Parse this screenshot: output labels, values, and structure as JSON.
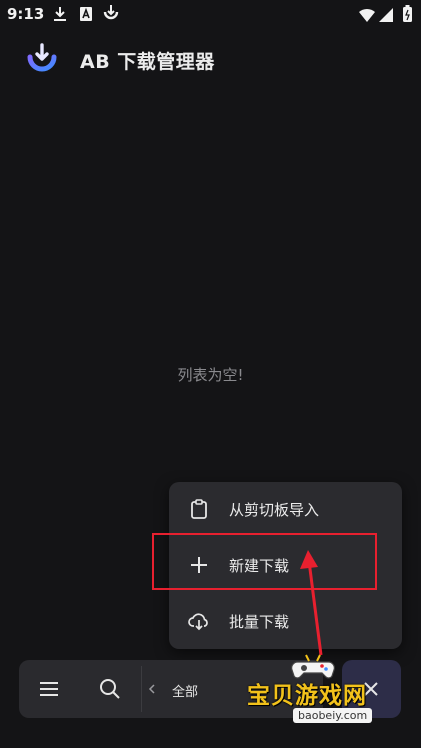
{
  "status_bar": {
    "time": "9:13",
    "left_icons": [
      "download-icon",
      "a-badge-icon",
      "app-download-icon"
    ],
    "right_icons": [
      "wifi-icon",
      "signal-icon",
      "battery-icon"
    ]
  },
  "app_bar": {
    "title": "AB 下载管理器",
    "logo_icon": "ab-download-logo-icon"
  },
  "main": {
    "empty_message": "列表为空!"
  },
  "popup_menu": {
    "items": [
      {
        "label": "从剪切板导入",
        "icon": "clipboard-icon"
      },
      {
        "label": "新建下载",
        "icon": "plus-icon"
      },
      {
        "label": "批量下载",
        "icon": "cloud-download-icon"
      }
    ]
  },
  "bottom_bar": {
    "menu_icon": "hamburger-menu-icon",
    "search_icon": "search-icon",
    "prev_icon": "chevron-left-icon",
    "filter_label": "全部"
  },
  "fab": {
    "icon": "close-icon"
  },
  "watermark": {
    "text": "宝贝游戏网",
    "url": "baobeiy.com"
  },
  "colors": {
    "background": "#141416",
    "menu_background": "#2b2b2f",
    "accent": "#5b4fd8",
    "highlight": "#e8202f",
    "watermark": "#f2c21b"
  }
}
